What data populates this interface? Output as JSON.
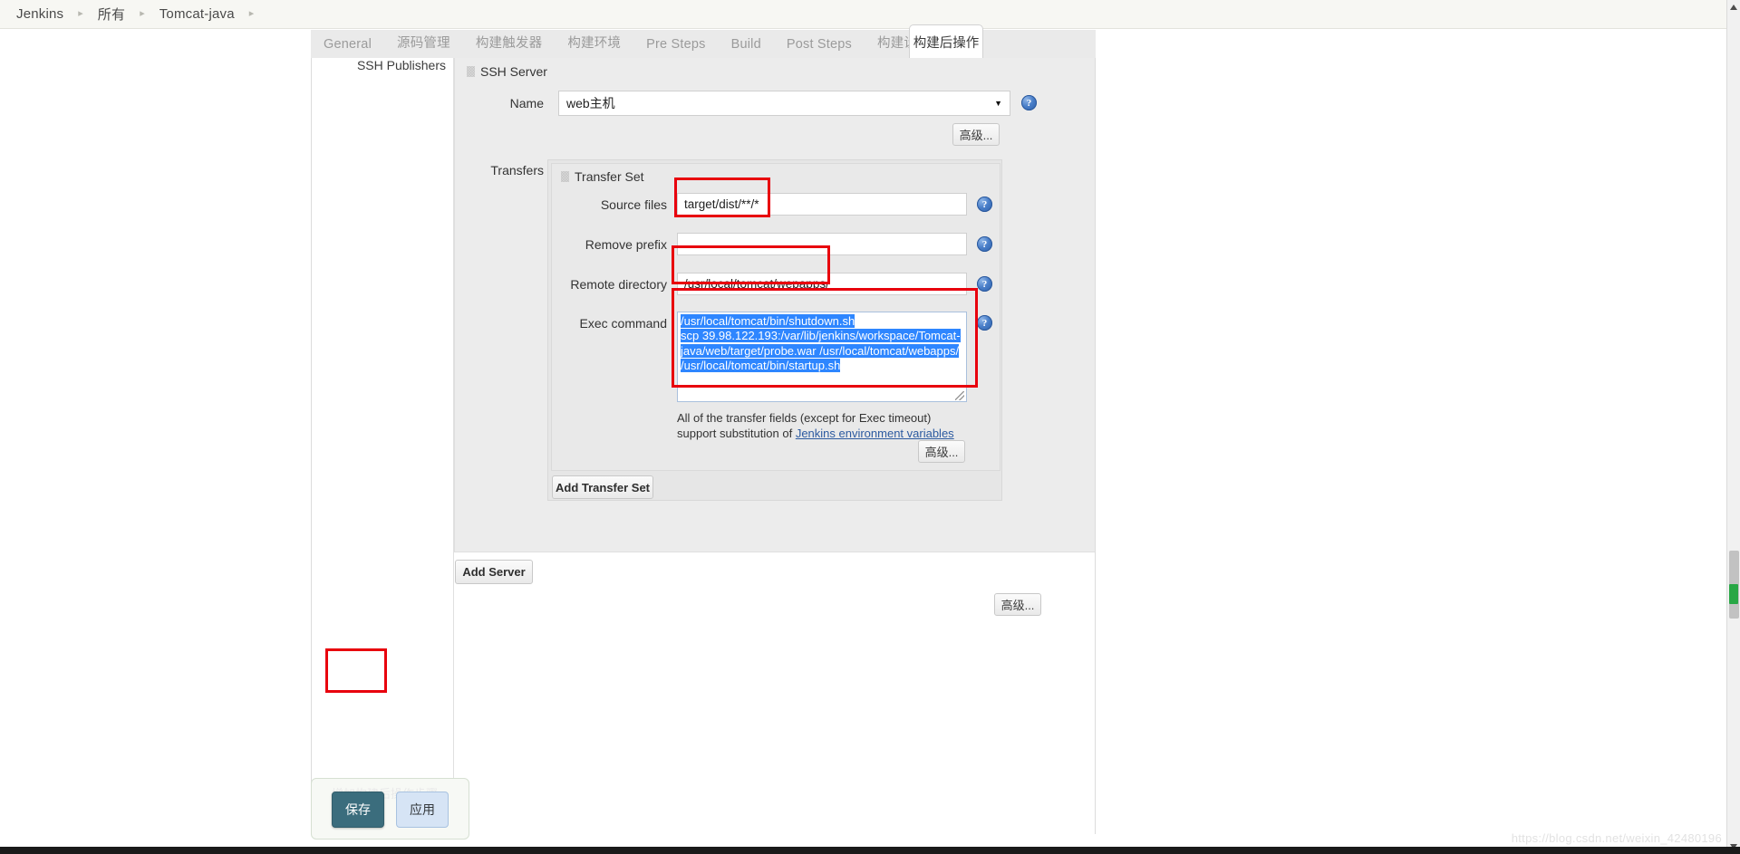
{
  "breadcrumb": {
    "items": [
      {
        "label": "Jenkins"
      },
      {
        "label": "所有"
      },
      {
        "label": "Tomcat-java"
      }
    ],
    "separator": "▸"
  },
  "tabs": [
    {
      "label": "General"
    },
    {
      "label": "源码管理"
    },
    {
      "label": "构建触发器"
    },
    {
      "label": "构建环境"
    },
    {
      "label": "Pre Steps"
    },
    {
      "label": "Build"
    },
    {
      "label": "Post Steps"
    },
    {
      "label": "构建设置"
    }
  ],
  "active_tab": {
    "label": "构建后操作"
  },
  "section": {
    "title": "SSH Publishers",
    "ssh_server_heading": "SSH Server",
    "name_label": "Name",
    "name_value": "web主机",
    "advanced_label": "高级...",
    "transfers_label": "Transfers",
    "transfer_set_heading": "Transfer Set",
    "fields": {
      "source_files_label": "Source files",
      "source_files_value": "target/dist/**/*",
      "remove_prefix_label": "Remove prefix",
      "remove_prefix_value": "",
      "remote_directory_label": "Remote directory",
      "remote_directory_value": "/usr/local/tomcat/wepapps/",
      "exec_command_label": "Exec command"
    },
    "exec_command_lines": [
      "/usr/local/tomcat/bin/shutdown.sh",
      "scp 39.98.122.193:/var/lib/jenkins/workspace/Tomcat-",
      "java/web/target/probe.war /usr/local/tomcat/webapps/",
      "/usr/local/tomcat/bin/startup.sh"
    ],
    "help_note_line1": "All of the transfer fields (except for Exec timeout)",
    "help_note_line2_prefix": "support substitution of ",
    "help_note_link": "Jenkins environment variables",
    "add_transfer_set_label": "Add Transfer Set",
    "add_server_label": "Add Server",
    "advanced_bottom_label": "高级...",
    "advanced_transfer_label": "高级...",
    "help_icon_glyph": "?"
  },
  "footer": {
    "save_label": "保存",
    "apply_label": "应用",
    "ghost_label": "增加构建后操作步骤"
  },
  "watermark": {
    "text": "https://blog.csdn.net/weixin_42480196"
  },
  "colors": {
    "accent_save": "#3b6d7d",
    "selection_blue": "#2e86ff",
    "annotation_red": "#e8000d",
    "link_blue": "#2c5aa0"
  }
}
